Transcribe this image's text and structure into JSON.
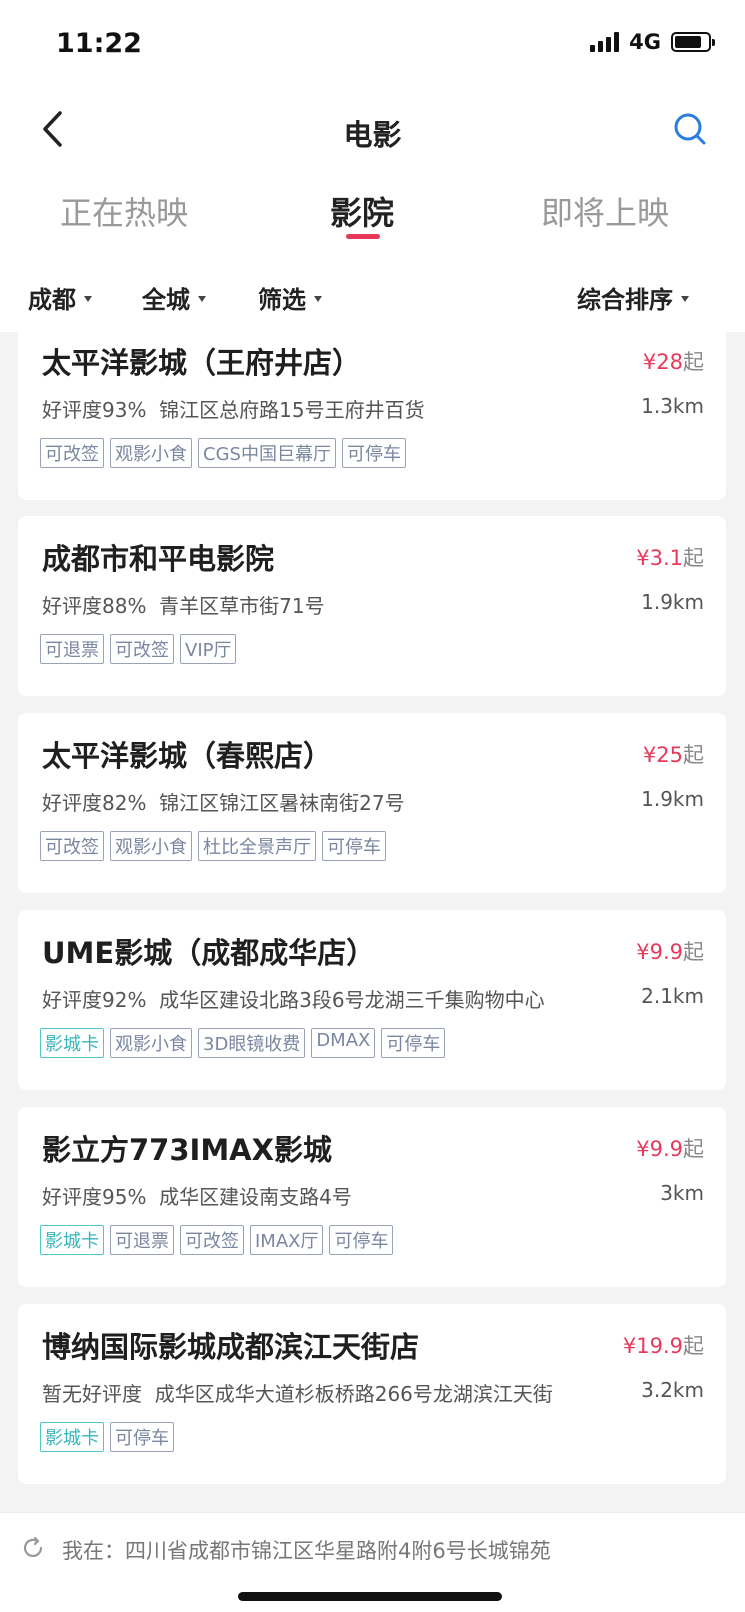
{
  "status_bar": {
    "time": "11:22",
    "network": "4G"
  },
  "nav": {
    "title": "电影",
    "back_icon": "chevron-left-icon",
    "search_icon": "search-icon"
  },
  "tabs": [
    {
      "label": "正在热映",
      "active": false
    },
    {
      "label": "影院",
      "active": true
    },
    {
      "label": "即将上映",
      "active": false
    }
  ],
  "filters": {
    "city": "成都",
    "district": "全城",
    "screen": "筛选",
    "sort": "综合排序"
  },
  "cinemas": [
    {
      "name": "太平洋影城（王府井店）",
      "price": "¥28",
      "price_suffix": "起",
      "rating": "好评度93%",
      "address": "锦江区总府路15号王府井百货",
      "distance": "1.3km",
      "tags": [
        {
          "label": "可改签",
          "special": false
        },
        {
          "label": "观影小食",
          "special": false
        },
        {
          "label": "CGS中国巨幕厅",
          "special": false
        },
        {
          "label": "可停车",
          "special": false
        }
      ]
    },
    {
      "name": "成都市和平电影院",
      "price": "¥3.1",
      "price_suffix": "起",
      "rating": "好评度88%",
      "address": "青羊区草市街71号",
      "distance": "1.9km",
      "tags": [
        {
          "label": "可退票",
          "special": false
        },
        {
          "label": "可改签",
          "special": false
        },
        {
          "label": "VIP厅",
          "special": false
        }
      ]
    },
    {
      "name": "太平洋影城（春熙店）",
      "price": "¥25",
      "price_suffix": "起",
      "rating": "好评度82%",
      "address": "锦江区锦江区暑袜南街27号",
      "distance": "1.9km",
      "tags": [
        {
          "label": "可改签",
          "special": false
        },
        {
          "label": "观影小食",
          "special": false
        },
        {
          "label": "杜比全景声厅",
          "special": false
        },
        {
          "label": "可停车",
          "special": false
        }
      ]
    },
    {
      "name": "UME影城（成都成华店）",
      "price": "¥9.9",
      "price_suffix": "起",
      "rating": "好评度92%",
      "address": "成华区建设北路3段6号龙湖三千集购物中心",
      "distance": "2.1km",
      "tags": [
        {
          "label": "影城卡",
          "special": true
        },
        {
          "label": "观影小食",
          "special": false
        },
        {
          "label": "3D眼镜收费",
          "special": false
        },
        {
          "label": "DMAX",
          "special": false
        },
        {
          "label": "可停车",
          "special": false
        }
      ]
    },
    {
      "name": "影立方773IMAX影城",
      "price": "¥9.9",
      "price_suffix": "起",
      "rating": "好评度95%",
      "address": "成华区建设南支路4号",
      "distance": "3km",
      "tags": [
        {
          "label": "影城卡",
          "special": true
        },
        {
          "label": "可退票",
          "special": false
        },
        {
          "label": "可改签",
          "special": false
        },
        {
          "label": "IMAX厅",
          "special": false
        },
        {
          "label": "可停车",
          "special": false
        }
      ]
    },
    {
      "name": "博纳国际影城成都滨江天街店",
      "price": "¥19.9",
      "price_suffix": "起",
      "rating": "暂无好评度",
      "address": "成华区成华大道杉板桥路266号龙湖滨江天街",
      "distance": "3.2km",
      "tags": [
        {
          "label": "影城卡",
          "special": true
        },
        {
          "label": "可停车",
          "special": false
        }
      ]
    }
  ],
  "location": {
    "text": "我在：四川省成都市锦江区华星路附4附6号长城锦苑"
  },
  "colors": {
    "accent": "#e8395b",
    "tag_border": "#9aa3b5",
    "tag_special": "#35b6bd",
    "search_icon": "#2a7de1"
  }
}
